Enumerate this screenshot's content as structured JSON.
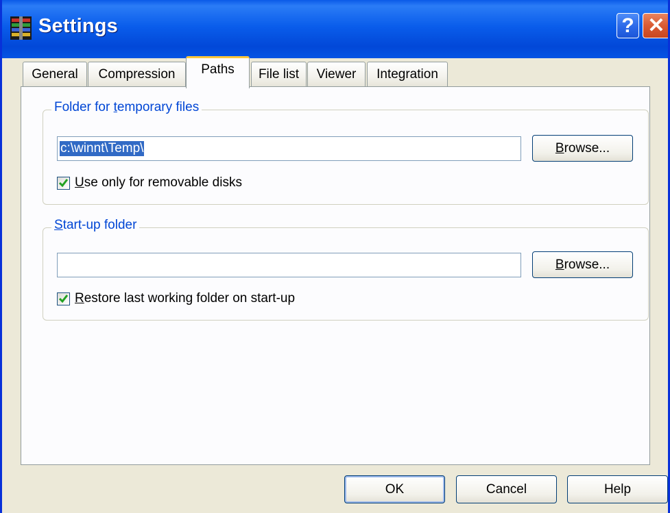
{
  "window": {
    "title": "Settings"
  },
  "titlebar": {
    "help_glyph": "?",
    "close_glyph": "✕"
  },
  "tabs": [
    {
      "label": "General",
      "active": false
    },
    {
      "label": "Compression",
      "active": false
    },
    {
      "label": "Paths",
      "active": true
    },
    {
      "label": "File list",
      "active": false
    },
    {
      "label": "Viewer",
      "active": false
    },
    {
      "label": "Integration",
      "active": false
    }
  ],
  "temp_folder": {
    "label_pre": "Folder for ",
    "label_key": "t",
    "label_post": "emporary files",
    "path_value": "c:\\winnt\\Temp\\",
    "browse_key": "B",
    "browse_rest": "rowse...",
    "checkbox_key": "U",
    "checkbox_rest": "se only for removable disks",
    "checkbox_checked": true
  },
  "startup_folder": {
    "label_key": "S",
    "label_rest": "tart-up folder",
    "path_value": "",
    "browse_key": "B",
    "browse_rest": "rowse...",
    "checkbox_key": "R",
    "checkbox_rest": "estore last working folder on start-up",
    "checkbox_checked": true
  },
  "buttons": {
    "ok": "OK",
    "cancel": "Cancel",
    "help": "Help"
  },
  "colors": {
    "titlebar": "#0A5DEB",
    "group_label": "#0046D5",
    "dialog_bg": "#ECE9D8",
    "active_tab_accent": "#FFC83C",
    "check": "#21A121"
  }
}
